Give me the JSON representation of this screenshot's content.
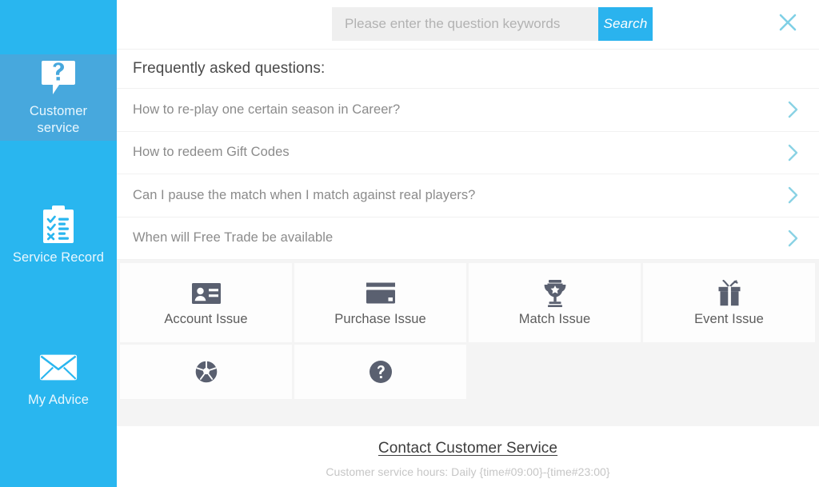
{
  "colors": {
    "sidebar_blue": "#29b6ef",
    "sidebar_active_blue": "#47a8dd",
    "search_button_blue": "#2ab3ee",
    "chevron_cyan": "#8ad2e4",
    "close_icon_cyan": "#7fd0e6",
    "icon_gray": "#5a6070",
    "faq_text_gray": "#8b8b8b"
  },
  "sidebar": {
    "items": [
      {
        "label": "Customer\nservice",
        "label_line1": "Customer",
        "label_line2": "service",
        "icon": "question-speech-bubble-icon",
        "active": true
      },
      {
        "label": "Service Record",
        "label_line1": "Service Record",
        "label_line2": "",
        "icon": "clipboard-checklist-icon",
        "active": false
      },
      {
        "label": "My Advice",
        "label_line1": "My Advice",
        "label_line2": "",
        "icon": "envelope-icon",
        "active": false
      }
    ]
  },
  "header": {
    "search": {
      "value": "",
      "placeholder": "Please enter the question keywords",
      "button_label": "Search"
    },
    "close_label": "×",
    "close_icon": "close-x-icon"
  },
  "main": {
    "faq_title": "Frequently asked questions:",
    "faq_items": [
      {
        "question": "How to re-play one certain season in Career?",
        "chevron": "chevron-right-icon"
      },
      {
        "question": "How to redeem Gift Codes",
        "chevron": "chevron-right-icon"
      },
      {
        "question": "Can I pause the match when I match against real players?",
        "chevron": "chevron-right-icon"
      },
      {
        "question": "When will Free Trade be available",
        "chevron": "chevron-right-icon"
      }
    ],
    "categories": [
      {
        "label": "Account Issue",
        "icon": "id-card-icon"
      },
      {
        "label": "Purchase Issue",
        "icon": "credit-card-icon"
      },
      {
        "label": "Match Issue",
        "icon": "trophy-icon"
      },
      {
        "label": "Event Issue",
        "icon": "gift-box-icon"
      },
      {
        "label": "",
        "icon": "soccer-ball-icon"
      },
      {
        "label": "",
        "icon": "question-mark-circle-icon"
      }
    ]
  },
  "footer": {
    "contact_link": "Contact Customer Service",
    "service_hours": "Customer service hours: Daily {time#09:00}-{time#23:00}"
  }
}
